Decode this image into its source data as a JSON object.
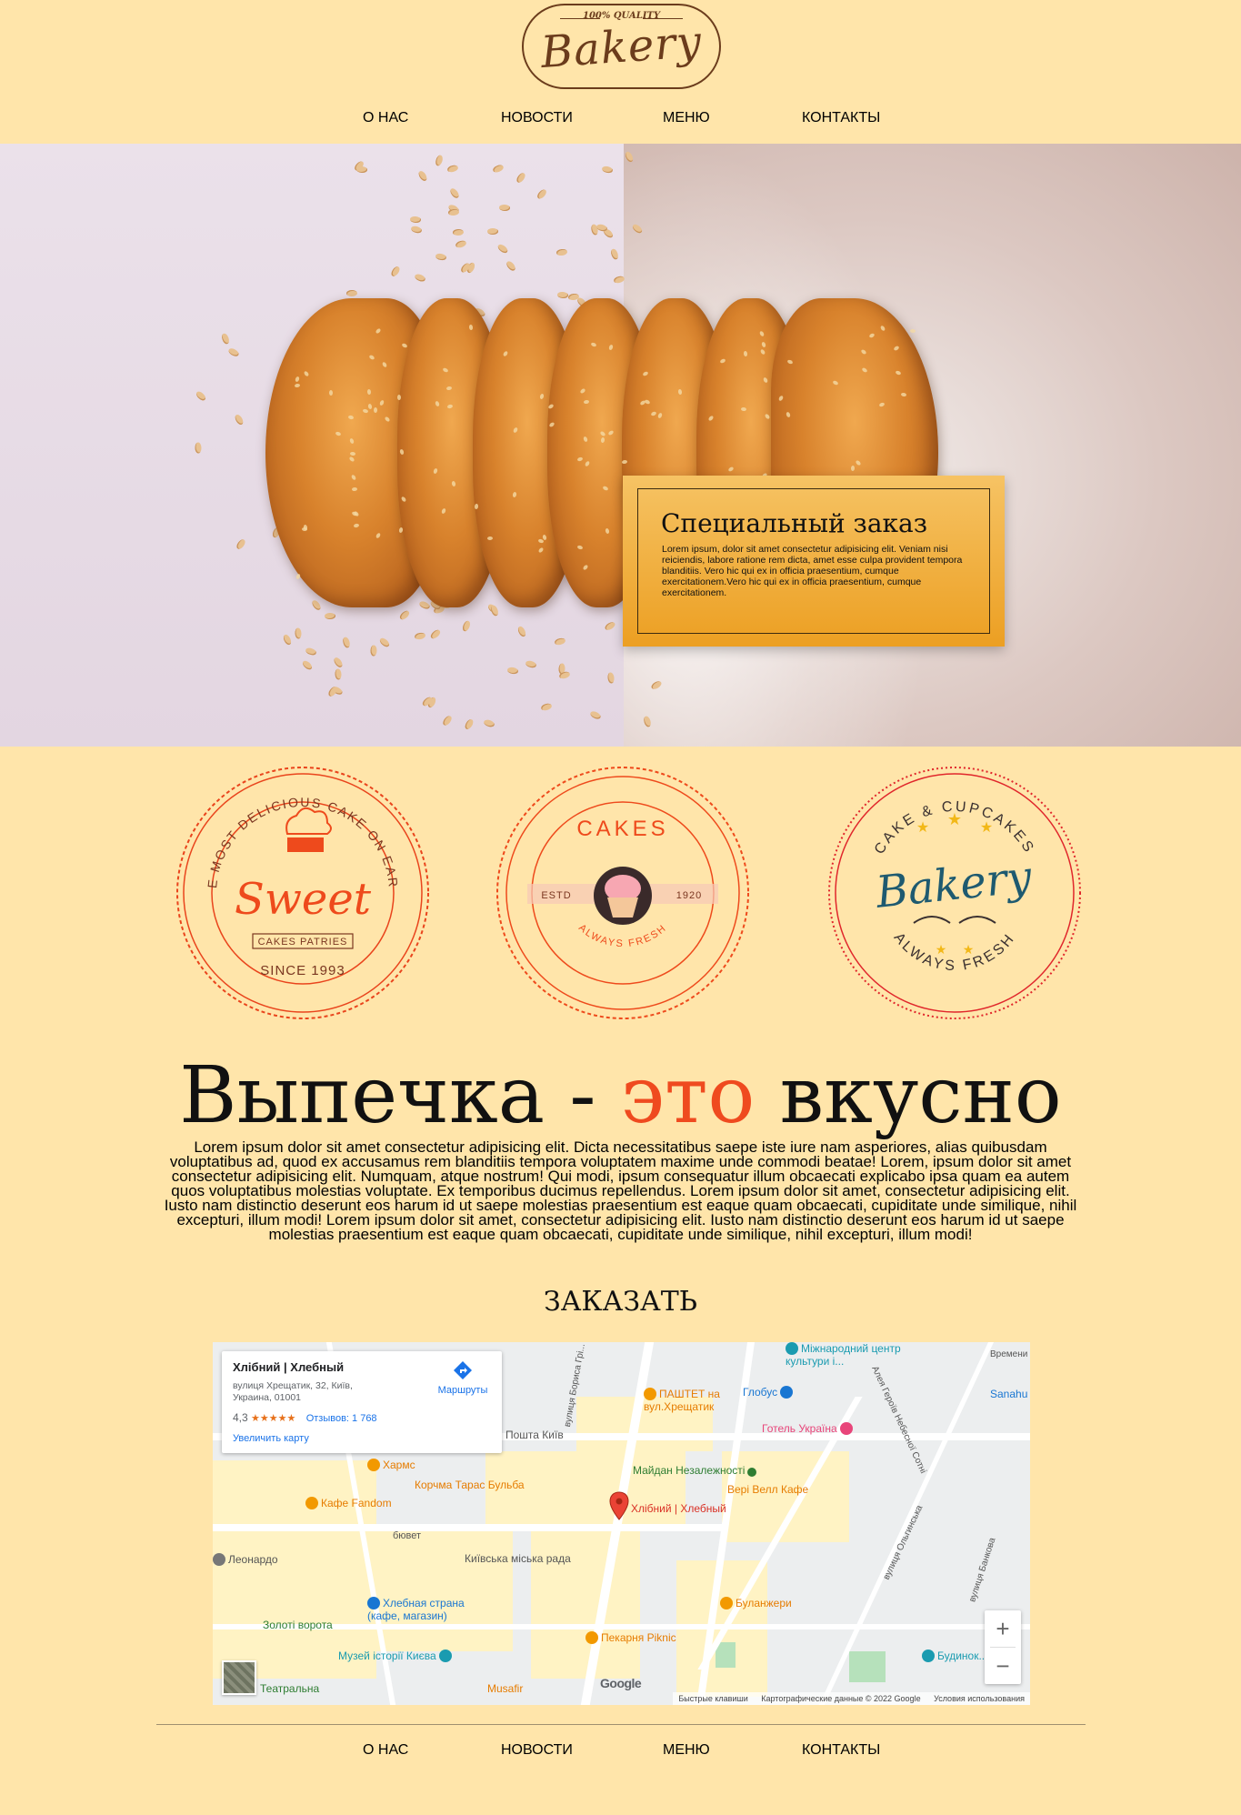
{
  "header": {
    "logo": {
      "quality": "100% QUALITY",
      "name": "Bakery"
    },
    "nav": [
      {
        "label": "О НАС"
      },
      {
        "label": "НОВОСТИ"
      },
      {
        "label": "МЕНЮ"
      },
      {
        "label": "КОНТАКТЫ"
      }
    ]
  },
  "hero": {
    "special": {
      "title": "Специальный заказ",
      "text": "Lorem ipsum, dolor sit amet consectetur adipisicing elit. Veniam nisi reiciendis, labore ratione rem dicta, amet esse culpa provident tempora blanditiis. Vero hic qui ex in officia praesentium, cumque exercitationem.Vero hic qui ex in officia praesentium, cumque exercitationem."
    }
  },
  "badges": [
    {
      "top_text": "THE MOST DELICIOUS CAKE ON EARTH",
      "main": "Sweet",
      "ribbon": "CAKES PATRIES",
      "bottom_text": "SINCE 1993"
    },
    {
      "top_text": "CAKES",
      "left": "ESTD",
      "right": "1920",
      "bottom_text": "ALWAYS FRESH"
    },
    {
      "top_text": "CAKE & CUPCAKES",
      "main": "Bakery",
      "bottom_text": "ALWAYS FRESH"
    }
  ],
  "content": {
    "title_part1": "Выпечка - ",
    "title_accent": "это",
    "title_part2": " вкусно",
    "body": "Lorem ipsum dolor sit amet consectetur adipisicing elit. Dicta necessitatibus saepe iste iure nam asperiores, alias quibusdam voluptatibus ad, quod ex accusamus rem blanditiis tempora voluptatem maxime unde commodi beatae! Lorem, ipsum dolor sit amet consectetur adipisicing elit. Numquam, atque nostrum! Qui modi, ipsum consequatur illum obcaecati explicabo ipsa quam ea autem quos voluptatibus molestias voluptate. Ex temporibus ducimus repellendus. Lorem ipsum dolor sit amet, consectetur adipisicing elit. Iusto nam distinctio deserunt eos harum id ut saepe molestias praesentium est eaque quam obcaecati, cupiditate unde similique, nihil excepturi, illum modi! Lorem ipsum dolor sit amet, consectetur adipisicing elit. Iusto nam distinctio deserunt eos harum id ut saepe molestias praesentium est eaque quam obcaecati, cupiditate unde similique, nihil excepturi, illum modi!",
    "order_label": "ЗАКАЗАТЬ"
  },
  "map": {
    "card": {
      "name": "Хлібний | Хлебный",
      "address": "вулиця Хрещатик, 32, Київ, Украина, 01001",
      "rating": "4,3",
      "stars": "★★★★★",
      "reviews": "Отзывов: 1 768",
      "enlarge": "Увеличить карту",
      "directions": "Маршруты"
    },
    "pin_label": "Хлібний | Хлебный",
    "pois": [
      {
        "label": "Міжнародний центр культури і...",
        "color": "#1a9bb0"
      },
      {
        "label": "Глобус",
        "color": "#1976d2"
      },
      {
        "label": "ПАШТЕТ на вул.Хрещатик",
        "color": "#f29900"
      },
      {
        "label": "Пошта Київ",
        "color": "#7b7b7b"
      },
      {
        "label": "Готель Україна",
        "color": "#e8457a"
      },
      {
        "label": "Хармс",
        "color": "#f29900"
      },
      {
        "label": "Корчма Тарас Бульба",
        "color": "#f29900"
      },
      {
        "label": "Майдан Незалежності",
        "color": "#2e7d32"
      },
      {
        "label": "Кафе Fandom",
        "color": "#f29900"
      },
      {
        "label": "Вері Велл Кафе",
        "color": "#f29900"
      },
      {
        "label": "бювет",
        "color": "#555555"
      },
      {
        "label": "Київська міська рада",
        "color": "#7b7b7b"
      },
      {
        "label": "Леонардо",
        "color": "#555555"
      },
      {
        "label": "Хлебная страна (кафе, магазин)",
        "color": "#1976d2"
      },
      {
        "label": "Буланжери",
        "color": "#f29900"
      },
      {
        "label": "Золоті ворота",
        "color": "#2e7d32"
      },
      {
        "label": "Пекарня Piknic",
        "color": "#f29900"
      },
      {
        "label": "Музей історії Києва",
        "color": "#1a9bb0"
      },
      {
        "label": "Театральна",
        "color": "#2e7d32"
      },
      {
        "label": "Musafir",
        "color": "#f29900"
      },
      {
        "label": "Будинок...",
        "color": "#1a9bb0"
      },
      {
        "label": "Sanahu",
        "color": "#1976d2"
      }
    ],
    "streets": [
      {
        "label": "вулиця Бориса Грі..."
      },
      {
        "label": "Алея Героїв Небесної Сотні"
      },
      {
        "label": "вулиця Ольгинська"
      },
      {
        "label": "вулиця Банкова"
      },
      {
        "label": "Времени"
      }
    ],
    "google": "Google",
    "footer": {
      "shortcuts": "Быстрые клавиши",
      "data": "Картографические данные © 2022 Google",
      "terms": "Условия использования"
    },
    "zoom_in": "+",
    "zoom_out": "−"
  },
  "footer": {
    "nav": [
      {
        "label": "О НАС"
      },
      {
        "label": "НОВОСТИ"
      },
      {
        "label": "МЕНЮ"
      },
      {
        "label": "КОНТАКТЫ"
      }
    ]
  },
  "colors": {
    "background": "#ffe5aa",
    "accent": "#ef4a1f",
    "special_box": "#f0a93a",
    "logo_brown": "#6b3c1c"
  }
}
